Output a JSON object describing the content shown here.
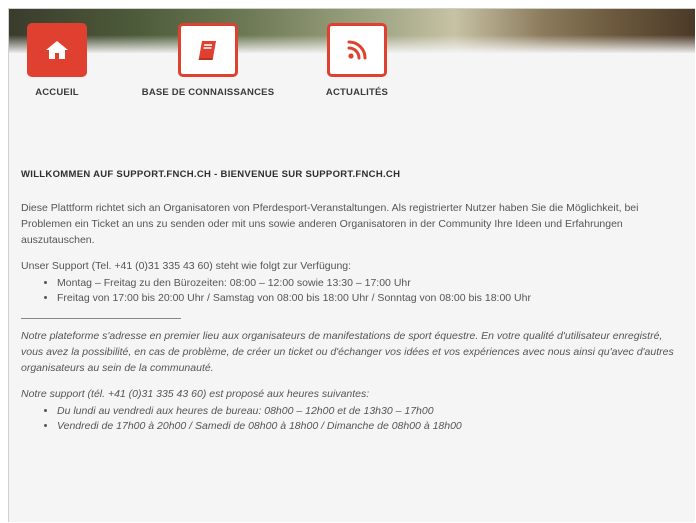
{
  "nav": {
    "items": [
      {
        "label": "ACCUEIL",
        "icon": "home-icon"
      },
      {
        "label": "BASE DE CONNAISSANCES",
        "icon": "book-icon"
      },
      {
        "label": "ACTUALITÉS",
        "icon": "rss-icon"
      }
    ]
  },
  "colors": {
    "accent": "#e0402f",
    "text": "#555555",
    "background": "#f5f5f5"
  },
  "content": {
    "welcome_title": "WILLKOMMEN AUF SUPPORT.FNCH.CH  - BIENVENUE SUR SUPPORT.FNCH.CH",
    "de_intro": "Diese Plattform richtet sich an Organisatoren von Pferdesport-Veranstaltungen. Als registrierter Nutzer haben Sie die Möglichkeit, bei Problemen ein Ticket an uns zu senden oder mit uns sowie anderen Organisatoren in der Community Ihre Ideen und Erfahrungen auszutauschen.",
    "de_support": "Unser Support (Tel. +41 (0)31 335 43 60) steht wie folgt zur Verfügung:",
    "de_hours": [
      "Montag – Freitag zu den Bürozeiten: 08:00 – 12:00 sowie 13:30 – 17:00 Uhr",
      "Freitag von 17:00 bis 20:00 Uhr / Samstag von 08:00 bis 18:00 Uhr / Sonntag von 08:00 bis 18:00 Uhr"
    ],
    "fr_intro": "Notre plateforme s'adresse en premier lieu aux organisateurs de manifestations de sport équestre. En votre qualité d'utilisateur enregistré, vous avez la possibilité, en cas de problème, de créer un ticket ou d'échanger vos idées et vos expériences avec nous ainsi qu'avec d'autres organisateurs au sein de la communauté.",
    "fr_support": "Notre support (tél. +41 (0)31 335 43 60) est proposé aux heures suivantes:",
    "fr_hours": [
      "Du lundi au vendredi aux heures de bureau: 08h00 – 12h00 et de 13h30 – 17h00",
      "Vendredi de 17h00 à 20h00 / Samedi de 08h00 à 18h00 / Dimanche de 08h00 à 18h00"
    ]
  }
}
